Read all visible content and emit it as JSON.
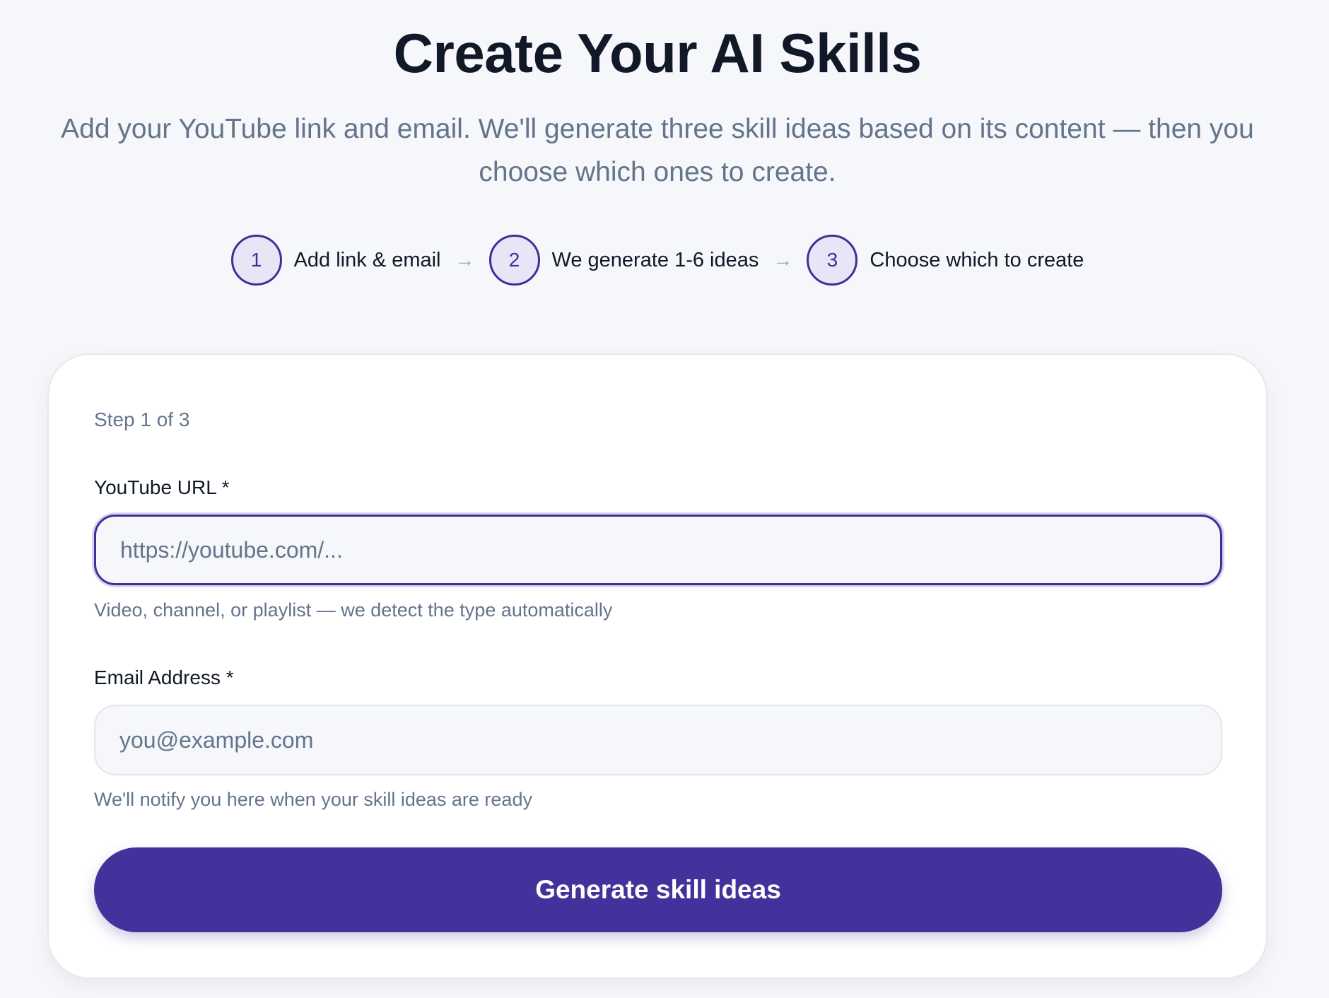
{
  "header": {
    "title": "Create Your AI Skills",
    "subtitle": "Add your YouTube link and email. We'll generate three skill ideas based on its content — then you choose which ones to create."
  },
  "stepper": {
    "steps": [
      {
        "number": "1",
        "label": "Add link & email"
      },
      {
        "number": "2",
        "label": "We generate 1-6 ideas"
      },
      {
        "number": "3",
        "label": "Choose which to create"
      }
    ],
    "arrow": "→"
  },
  "form": {
    "step_indicator": "Step 1 of 3",
    "youtube": {
      "label": "YouTube URL *",
      "value": "",
      "placeholder": "https://youtube.com/...",
      "help": "Video, channel, or playlist — we detect the type automatically"
    },
    "email": {
      "label": "Email Address *",
      "value": "",
      "placeholder": "you@example.com",
      "help": "We'll notify you here when your skill ideas are ready"
    },
    "submit_label": "Generate skill ideas"
  },
  "colors": {
    "accent": "#44319b",
    "background": "#f5f7fa",
    "muted_text": "#64748b"
  }
}
